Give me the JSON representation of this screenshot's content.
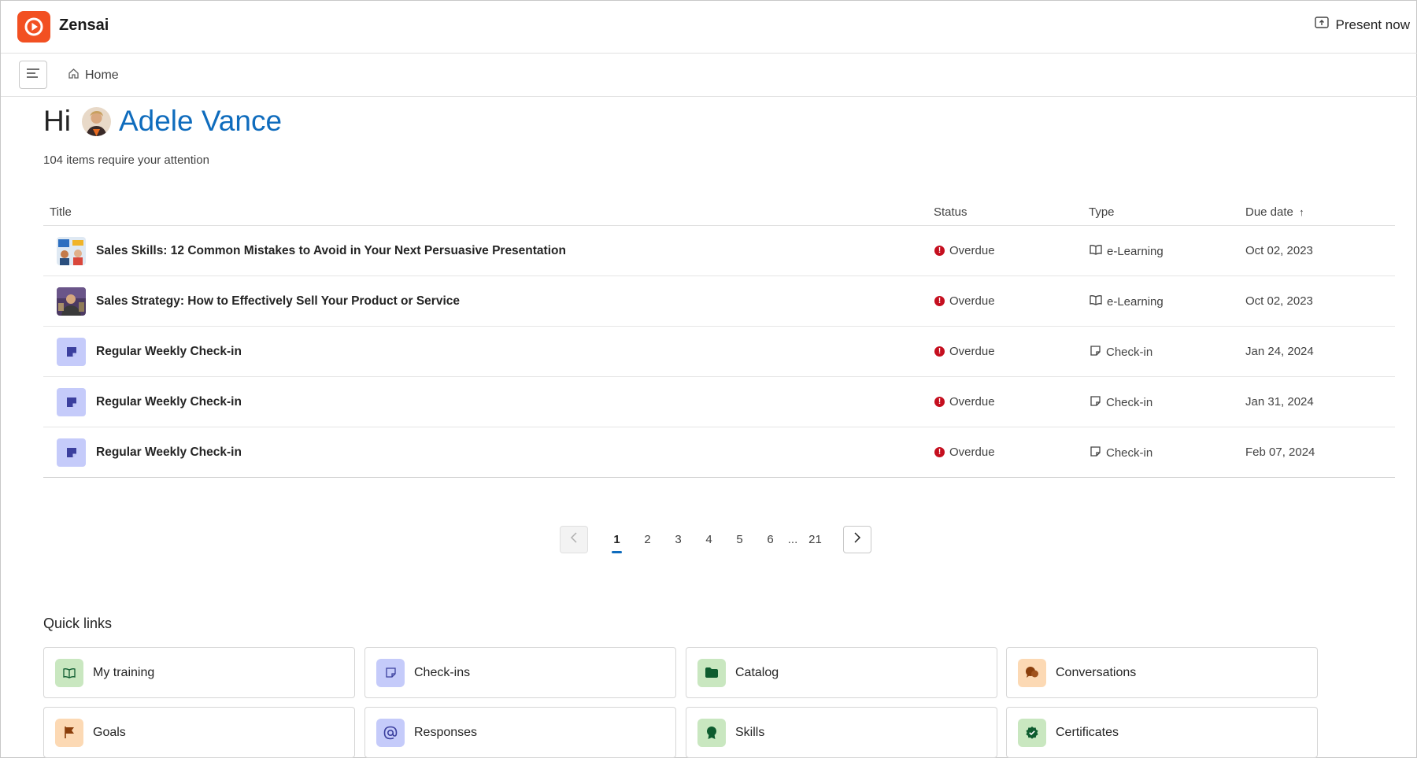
{
  "app": {
    "name": "Zensai",
    "present_label": "Present now",
    "brand_color": "#f25022"
  },
  "breadcrumb": {
    "home_label": "Home"
  },
  "greeting": {
    "hi": "Hi",
    "name": "Adele Vance",
    "subtext": "104 items require your attention",
    "name_color": "#0f6cbd"
  },
  "table": {
    "headers": {
      "title": "Title",
      "status": "Status",
      "type": "Type",
      "due": "Due date"
    },
    "sort_indicator": "↑",
    "rows": [
      {
        "thumb": "sales-skills-image",
        "title": "Sales Skills: 12 Common Mistakes to Avoid in Your Next Persuasive Presentation",
        "status": "Overdue",
        "type": "e-Learning",
        "type_icon": "book-icon",
        "due": "Oct 02, 2023"
      },
      {
        "thumb": "sales-strategy-image",
        "title": "Sales Strategy: How to Effectively Sell Your Product or Service",
        "status": "Overdue",
        "type": "e-Learning",
        "type_icon": "book-icon",
        "due": "Oct 02, 2023"
      },
      {
        "thumb": "checkin-icon",
        "title": "Regular Weekly Check-in",
        "status": "Overdue",
        "type": "Check-in",
        "type_icon": "note-icon",
        "due": "Jan 24, 2024"
      },
      {
        "thumb": "checkin-icon",
        "title": "Regular Weekly Check-in",
        "status": "Overdue",
        "type": "Check-in",
        "type_icon": "note-icon",
        "due": "Jan 31, 2024"
      },
      {
        "thumb": "checkin-icon",
        "title": "Regular Weekly Check-in",
        "status": "Overdue",
        "type": "Check-in",
        "type_icon": "note-icon",
        "due": "Feb 07, 2024"
      }
    ],
    "status_color": "#c50f1f"
  },
  "pagination": {
    "pages": [
      "1",
      "2",
      "3",
      "4",
      "5",
      "6"
    ],
    "ellipsis": "...",
    "last": "21",
    "current": "1"
  },
  "quick_links": {
    "title": "Quick links",
    "items": [
      {
        "label": "My training",
        "icon": "book-icon",
        "bg": "#c9e7c0"
      },
      {
        "label": "Check-ins",
        "icon": "note-icon",
        "bg": "#c5cbfa"
      },
      {
        "label": "Catalog",
        "icon": "folder-icon",
        "bg": "#c9e7c0"
      },
      {
        "label": "Conversations",
        "icon": "chat-icon",
        "bg": "#fcd9b4"
      },
      {
        "label": "Goals",
        "icon": "flag-icon",
        "bg": "#fcd9b4"
      },
      {
        "label": "Responses",
        "icon": "at-icon",
        "bg": "#c5cbfa"
      },
      {
        "label": "Skills",
        "icon": "award-icon",
        "bg": "#c9e7c0"
      },
      {
        "label": "Certificates",
        "icon": "certificate-icon",
        "bg": "#c9e7c0"
      }
    ]
  }
}
